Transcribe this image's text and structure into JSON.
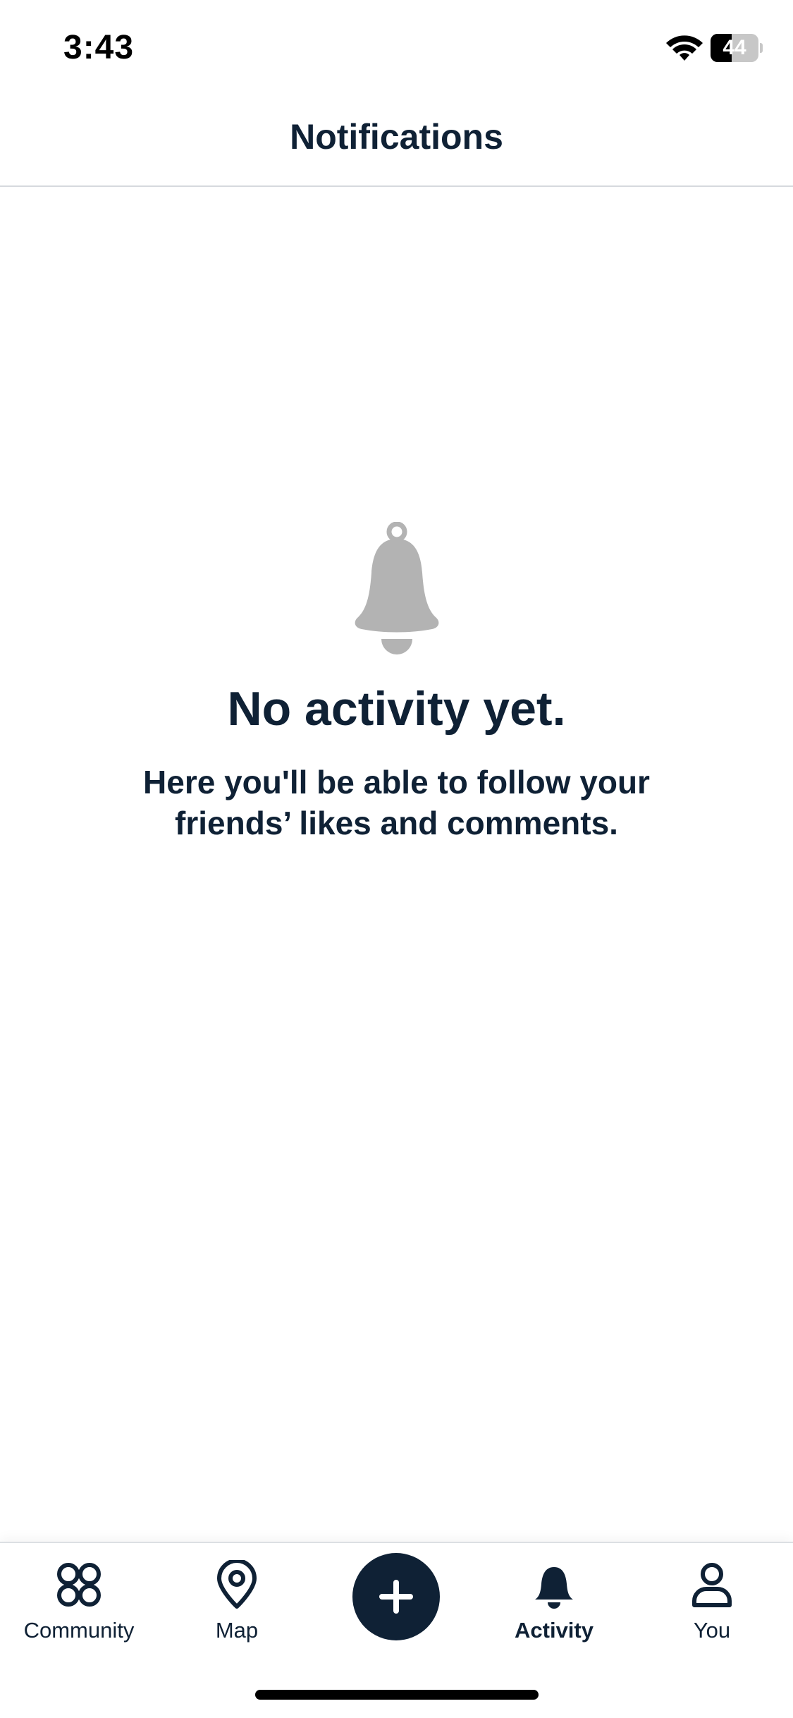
{
  "status_bar": {
    "time": "3:43",
    "battery_level": "44",
    "battery_fraction": 0.44
  },
  "header": {
    "title": "Notifications"
  },
  "empty_state": {
    "icon": "bell-icon",
    "title": "No activity yet.",
    "message": "Here you'll be able to follow your friends’ likes and comments."
  },
  "tab_bar": {
    "tabs": [
      {
        "label": "Community",
        "icon": "community-grid-icon",
        "active": false
      },
      {
        "label": "Map",
        "icon": "map-pin-icon",
        "active": false
      },
      {
        "label": "Activity",
        "icon": "bell-icon",
        "active": true
      },
      {
        "label": "You",
        "icon": "person-icon",
        "active": false
      }
    ],
    "add_button_icon": "plus-icon"
  },
  "colors": {
    "primary": "#0f2135",
    "muted_icon": "#b3b3b3",
    "divider": "#d6d9de"
  }
}
